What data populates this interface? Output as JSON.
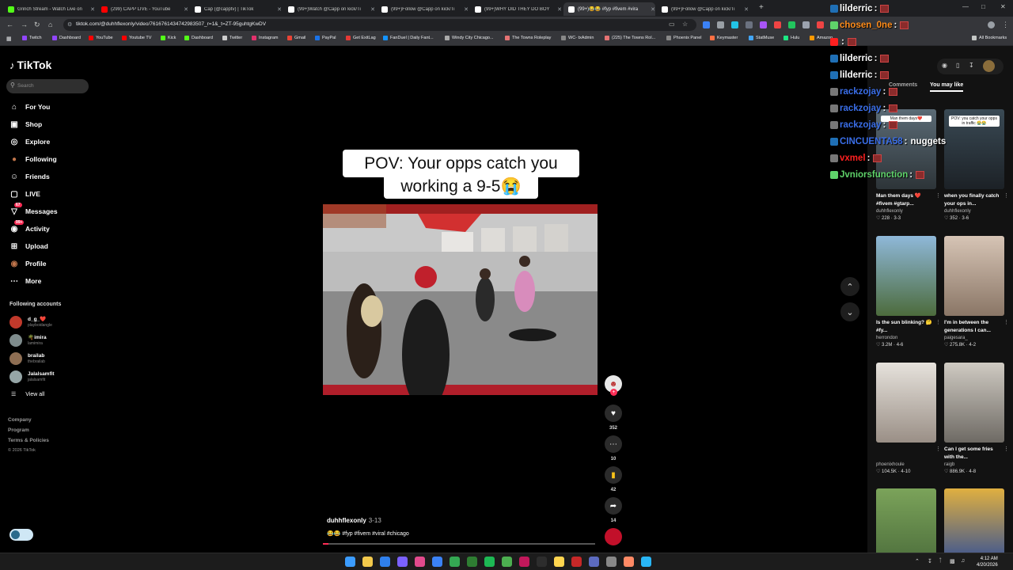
{
  "browser": {
    "tabs": [
      {
        "title": "Grinch Stream - Watch Live on",
        "color": "#53fc18"
      },
      {
        "title": "(299) CAPP LIVE - YouTube",
        "color": "#ff0000"
      },
      {
        "title": "Cap (@capptv) | TikTok",
        "color": "#ffffff"
      },
      {
        "title": "(99+)Watch @Capp on kick/Ti",
        "color": "#ffffff"
      },
      {
        "title": "(99+)Follow @Capp on kick/Ti",
        "color": "#ffffff"
      },
      {
        "title": "(99+)WHY DID THEY DO BOY",
        "color": "#ffffff"
      },
      {
        "title": "(99+)😂😂 #fyp #fivem #vira",
        "color": "#ffffff"
      },
      {
        "title": "(99+)Follow @Capp on kick/Ti",
        "color": "#ffffff"
      }
    ],
    "url": "tiktok.com/@duhhflexonly/video/7616761434742983507_r=1&_t=ZT-95guhtgKwDV",
    "bookmarks": [
      {
        "label": "Twitch",
        "color": "#9146ff"
      },
      {
        "label": "Dashboard",
        "color": "#9146ff"
      },
      {
        "label": "YouTube",
        "color": "#ff0000"
      },
      {
        "label": "Youtube TV",
        "color": "#ff0000"
      },
      {
        "label": "Kick",
        "color": "#53fc18"
      },
      {
        "label": "Dashboard",
        "color": "#53fc18"
      },
      {
        "label": "Twitter",
        "color": "#cccccc"
      },
      {
        "label": "Instagram",
        "color": "#e1306c"
      },
      {
        "label": "Gmail",
        "color": "#ea4335"
      },
      {
        "label": "PayPal",
        "color": "#1a73e8"
      },
      {
        "label": "Get ExitLag",
        "color": "#e53935"
      },
      {
        "label": "FanDuel | Daily Fant...",
        "color": "#1493ff"
      },
      {
        "label": "Windy City Chicago...",
        "color": "#aaaaaa"
      },
      {
        "label": "The Towns Roleplay",
        "color": "#e57373"
      },
      {
        "label": "WC- txAdmin",
        "color": "#888888"
      },
      {
        "label": "(225) The Towns Rol...",
        "color": "#e57373"
      },
      {
        "label": "Phoenix Panel",
        "color": "#888888"
      },
      {
        "label": "Keymaster",
        "color": "#ff7043"
      },
      {
        "label": "StatMuse",
        "color": "#42a5f5"
      },
      {
        "label": "Hulu",
        "color": "#1ce783"
      },
      {
        "label": "Amazon",
        "color": "#ff9900"
      }
    ],
    "all_bookmarks": "All Bookmarks"
  },
  "tiktok": {
    "brand": "TikTok",
    "search_placeholder": "Search",
    "nav": [
      {
        "label": "For You",
        "icon": "home-icon"
      },
      {
        "label": "Shop",
        "icon": "shop-icon"
      },
      {
        "label": "Explore",
        "icon": "compass-icon"
      },
      {
        "label": "Following",
        "icon": "following-avatar-icon"
      },
      {
        "label": "Friends",
        "icon": "friends-icon"
      },
      {
        "label": "LIVE",
        "icon": "live-icon"
      },
      {
        "label": "Messages",
        "icon": "messages-icon",
        "badge": "67"
      },
      {
        "label": "Activity",
        "icon": "activity-icon",
        "badge": "99+"
      },
      {
        "label": "Upload",
        "icon": "upload-icon"
      },
      {
        "label": "Profile",
        "icon": "profile-icon"
      },
      {
        "label": "More",
        "icon": "more-icon"
      }
    ],
    "following_header": "Following accounts",
    "accounts": [
      {
        "name": "d_g_❤️",
        "handle": "playboidangle",
        "color": "#c0392b"
      },
      {
        "name": "🌴imira",
        "handle": "lamimira",
        "color": "#7f8c8d"
      },
      {
        "name": "brailab",
        "handle": "thebrailab",
        "color": "#8e6e53"
      },
      {
        "name": "Jalalsamfit",
        "handle": "jalalsamfit",
        "color": "#95a5a6"
      }
    ],
    "view_all": "View all",
    "footer": {
      "company": "Company",
      "program": "Program",
      "terms": "Terms & Policies",
      "copyright": "© 2026 TikTok"
    },
    "video": {
      "caption_line1": "POV: Your opps catch you",
      "caption_line2": "working a 9-5😭",
      "author": "duhhflexonly",
      "date": "3-13",
      "tags": "😂😂 #fyp #fivem #viral #chicago",
      "progress": 0.02
    },
    "actions": {
      "likes": "352",
      "comments": "10",
      "saves": "42",
      "shares": "14"
    },
    "right_tabs": {
      "comments": "Comments",
      "you_may_like": "You may like"
    },
    "cards": [
      {
        "title": "Man them days ❤️ #fivem #gtarp...",
        "user": "duhhflexonly",
        "stats": "♡ 228 · 3-3",
        "thumb_text": "Man them days❤️",
        "c1": "#5b6b76",
        "c2": "#2d3438"
      },
      {
        "title": "when you finally catch your ops in...",
        "user": "duhhflexonly",
        "stats": "♡ 352 · 3-6",
        "thumb_text": "POV: you catch your opps in traffic 😭😭",
        "c1": "#3a4a55",
        "c2": "#1c2126"
      },
      {
        "title": "Is the sun blinking? 🤔 #fy...",
        "user": "herrondon",
        "stats": "♡ 3.2M · 4-6",
        "thumb_text": "",
        "c1": "#8fb8d9",
        "c2": "#4c6b3c"
      },
      {
        "title": "I'm in between the generations I can...",
        "user": "paigesara_",
        "stats": "♡ 275.8K · 4-2",
        "thumb_text": "",
        "c1": "#d6c4b5",
        "c2": "#8a7666"
      },
      {
        "title": "",
        "user": "phoenixhoule",
        "stats": "♡ 104.5K · 4-10",
        "thumb_text": "",
        "c1": "#e6e2dc",
        "c2": "#9a8f86"
      },
      {
        "title": "Can I get some fries with the...",
        "user": "raigb",
        "stats": "♡ 886.9K · 4-8",
        "thumb_text": "",
        "c1": "#cfcac2",
        "c2": "#6e6a64"
      },
      {
        "title": "",
        "user": "",
        "stats": "",
        "thumb_text": "",
        "c1": "#7ba35a",
        "c2": "#4a6b3a"
      },
      {
        "title": "",
        "user": "",
        "stats": "",
        "thumb_text": "",
        "c1": "#e0b040",
        "c2": "#2a4a9a"
      }
    ]
  },
  "chat": [
    {
      "user": "lilderric",
      "color": "#ffffff",
      "msg": ""
    },
    {
      "user": "chosen_0ne",
      "color": "#ff8c1a",
      "msg": ""
    },
    {
      "user": "",
      "color": "#ff2020",
      "msg": ""
    },
    {
      "user": "lilderric",
      "color": "#ffffff",
      "msg": ""
    },
    {
      "user": "lilderric",
      "color": "#ffffff",
      "msg": ""
    },
    {
      "user": "rackzojay",
      "color": "#3a6ee8",
      "msg": ""
    },
    {
      "user": "rackzojay",
      "color": "#3a6ee8",
      "msg": ""
    },
    {
      "user": "rackzojay",
      "color": "#3a6ee8",
      "msg": ""
    },
    {
      "user": "CINCUENTA58",
      "color": "#3a6ee8",
      "msg": "nuggets"
    },
    {
      "user": "vxmel",
      "color": "#ff2020",
      "msg": ""
    },
    {
      "user": "Jvniorsfunction",
      "color": "#5fd36a",
      "msg": ""
    }
  ],
  "taskbar": {
    "time": "4:12 AM",
    "date": "4/20/2026"
  }
}
